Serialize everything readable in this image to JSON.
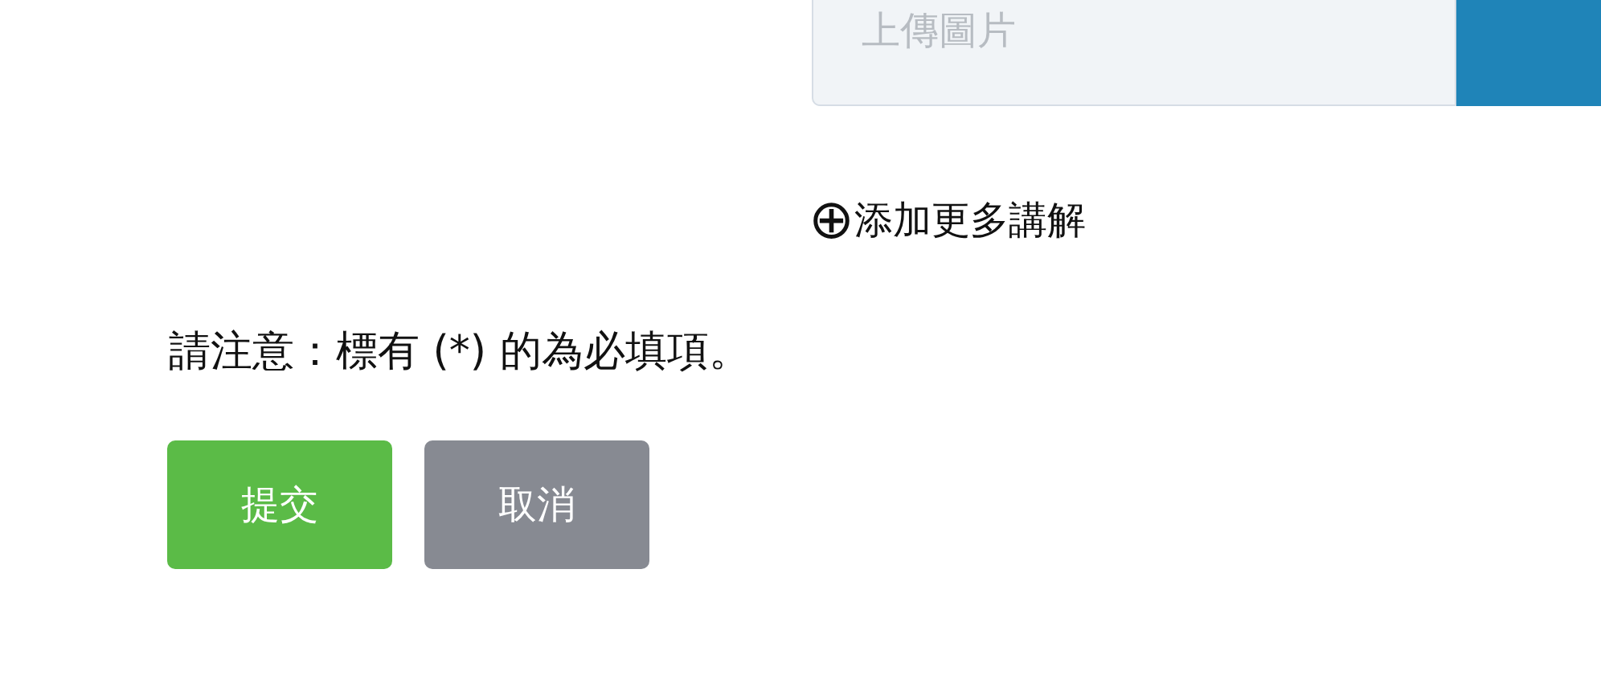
{
  "upload": {
    "placeholder": "上傳圖片"
  },
  "add_more": {
    "icon": "⊕",
    "label": "添加更多講解"
  },
  "note": "請注意：標有 (*) 的為必填項。",
  "buttons": [
    {
      "kind": "primary",
      "label": "提交"
    },
    {
      "kind": "secondary",
      "label": "取消"
    }
  ]
}
